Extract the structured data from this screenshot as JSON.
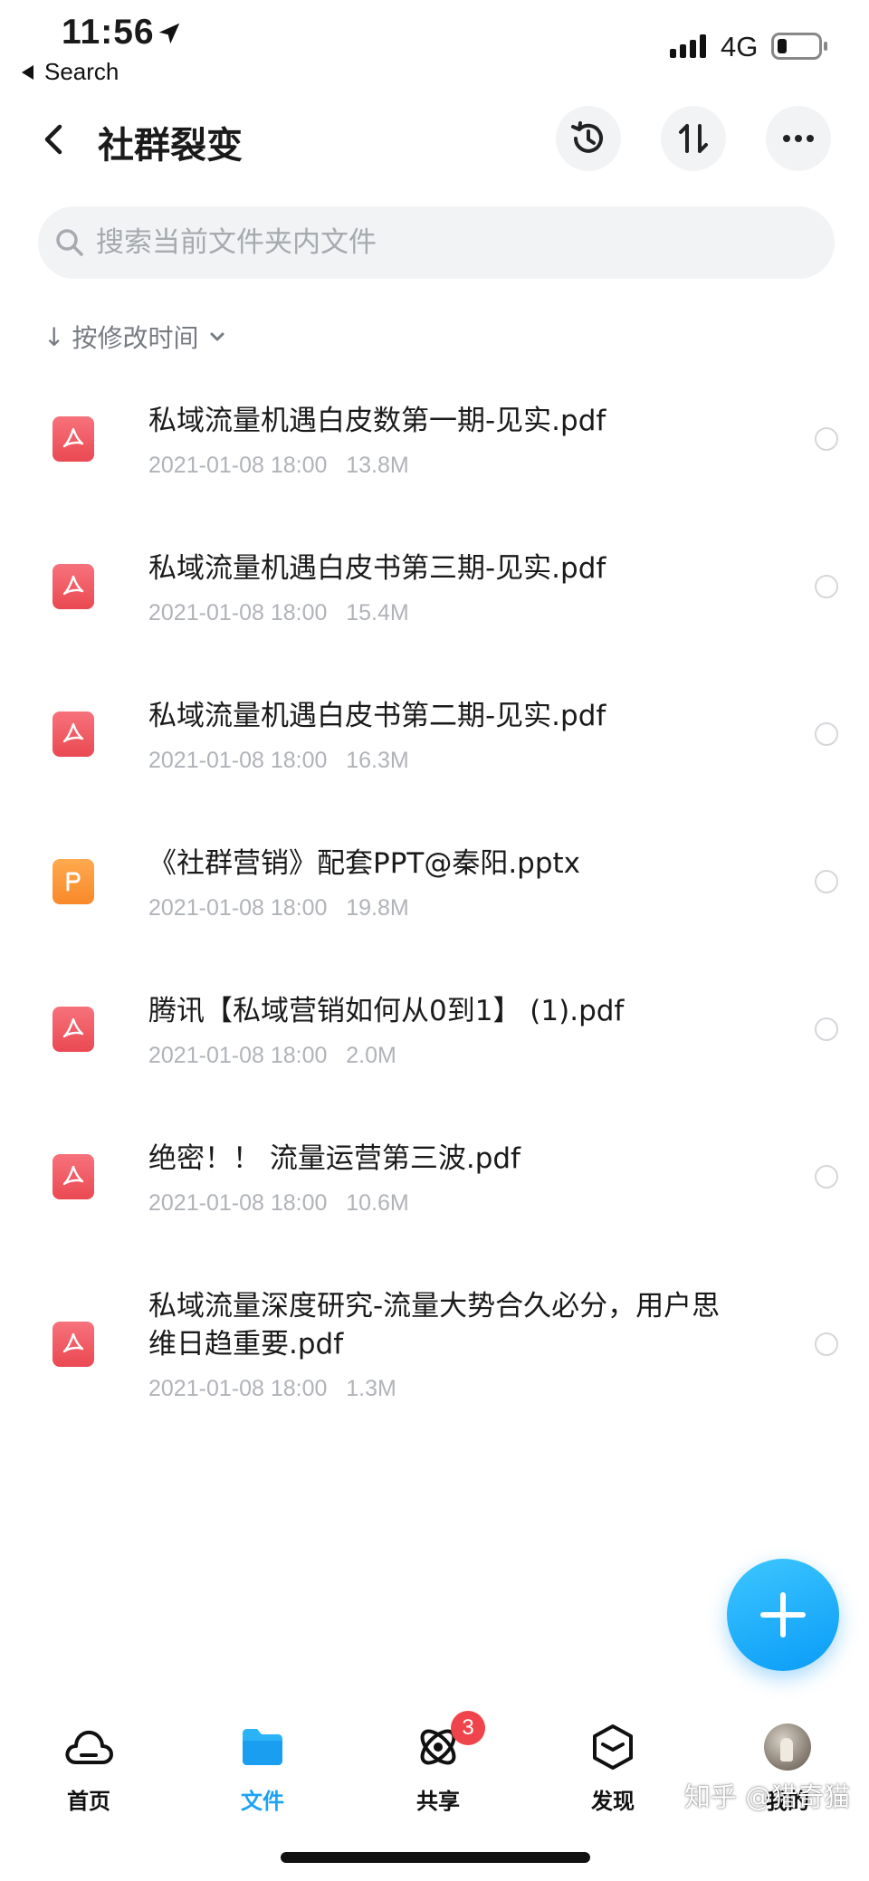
{
  "status_bar": {
    "time": "11:56",
    "back_label": "Search",
    "network": "4G"
  },
  "header": {
    "title": "社群裂变"
  },
  "search": {
    "placeholder": "搜索当前文件夹内文件"
  },
  "sort": {
    "label": "按修改时间"
  },
  "files": [
    {
      "name": "私域流量机遇白皮数第一期-见实.pdf",
      "date": "2021-01-08 18:00",
      "size": "13.8M",
      "type": "pdf"
    },
    {
      "name": "私域流量机遇白皮书第三期-见实.pdf",
      "date": "2021-01-08 18:00",
      "size": "15.4M",
      "type": "pdf"
    },
    {
      "name": "私域流量机遇白皮书第二期-见实.pdf",
      "date": "2021-01-08 18:00",
      "size": "16.3M",
      "type": "pdf"
    },
    {
      "name": "《社群营销》配套PPT@秦阳.pptx",
      "date": "2021-01-08 18:00",
      "size": "19.8M",
      "type": "ppt"
    },
    {
      "name": "腾讯【私域营销如何从0到1】 (1).pdf",
      "date": "2021-01-08 18:00",
      "size": "2.0M",
      "type": "pdf"
    },
    {
      "name": "绝密！！ 流量运营第三波.pdf",
      "date": "2021-01-08 18:00",
      "size": "10.6M",
      "type": "pdf"
    },
    {
      "name": "私域流量深度研究-流量大势合久必分，用户思维日趋重要.pdf",
      "date": "2021-01-08 18:00",
      "size": "1.3M",
      "type": "pdf"
    }
  ],
  "tabbar": {
    "home": "首页",
    "files": "文件",
    "share": "共享",
    "share_badge": "3",
    "discover": "发现",
    "mine": "我的"
  },
  "watermark": "知乎 @猎奇猫",
  "colors": {
    "accent": "#1aa3f5",
    "pdf": "#f0535c",
    "ppt": "#f8892a",
    "badge": "#f0444c"
  }
}
